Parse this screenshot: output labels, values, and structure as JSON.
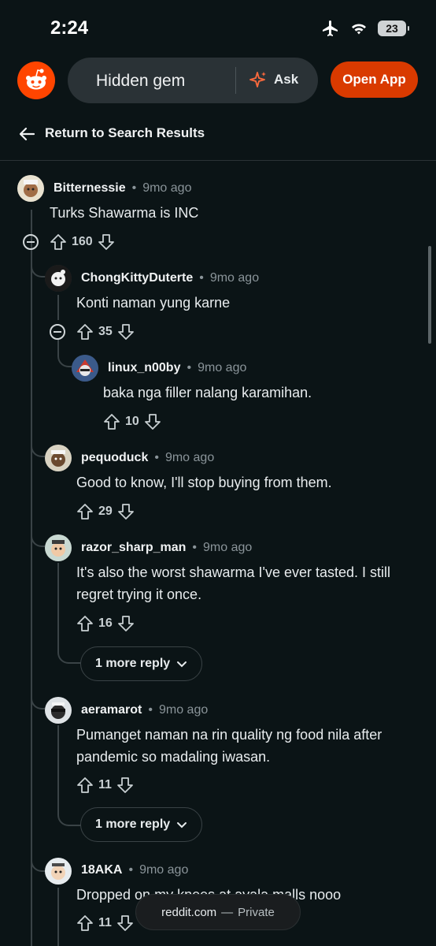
{
  "status": {
    "time": "2:24",
    "battery": "23"
  },
  "header": {
    "search_text": "Hidden gem",
    "ask_label": "Ask",
    "open_app_label": "Open App"
  },
  "back": {
    "label": "Return to Search Results"
  },
  "comments": [
    {
      "author": "Bitternessie",
      "ago": "9mo ago",
      "text": "Turks Shawarma is INC",
      "votes": "160"
    },
    {
      "author": "ChongKittyDuterte",
      "ago": "9mo ago",
      "text": "Konti naman yung karne",
      "votes": "35"
    },
    {
      "author": "linux_n00by",
      "ago": "9mo ago",
      "text": "baka nga filler nalang karamihan.",
      "votes": "10"
    },
    {
      "author": "pequoduck",
      "ago": "9mo ago",
      "text": "Good to know, I'll stop buying from them.",
      "votes": "29"
    },
    {
      "author": "razor_sharp_man",
      "ago": "9mo ago",
      "text": "It's also the worst shawarma I've ever tasted. I still regret trying it once.",
      "votes": "16"
    },
    {
      "author": "aeramarot",
      "ago": "9mo ago",
      "text": "Pumanget naman na rin quality ng food nila after pandemic so madaling iwasan.",
      "votes": "11"
    },
    {
      "author": "18AKA",
      "ago": "9mo ago",
      "text": "Dropped on my knees at ayala malls nooo",
      "votes": "11"
    }
  ],
  "more_replies": [
    "1 more reply",
    "1 more reply"
  ],
  "url_pill": {
    "domain": "reddit.com",
    "sep": "—",
    "mode": "Private"
  },
  "colors": {
    "accent": "#d93a00",
    "logo": "#ff4500",
    "background": "#0b1416"
  }
}
